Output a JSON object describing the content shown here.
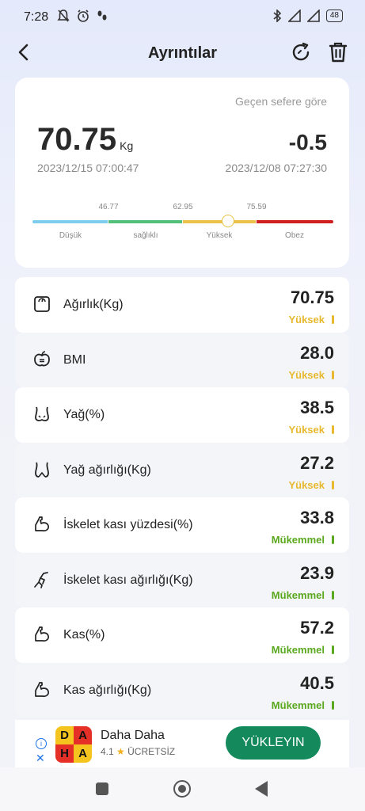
{
  "status_bar": {
    "time": "7:28",
    "battery": "48"
  },
  "header": {
    "title": "Ayrıntılar"
  },
  "summary": {
    "compare_label": "Geçen sefere göre",
    "weight": "70.75",
    "unit": "Kg",
    "difference": "-0.5",
    "current_date": "2023/12/15 07:00:47",
    "previous_date": "2023/12/08 07:27:30",
    "scale": {
      "ticks": [
        "46.77",
        "62.95",
        "75.59"
      ],
      "segments": [
        {
          "label": "Düşük",
          "color": "#7ccdee"
        },
        {
          "label": "sağlıklı",
          "color": "#52c07a"
        },
        {
          "label": "Yüksek",
          "color": "#ecc34a"
        },
        {
          "label": "Obez",
          "color": "#cf1f1f"
        }
      ],
      "marker_value": 70.75
    }
  },
  "metrics": [
    {
      "icon": "scale-icon",
      "label": "Ağırlık(Kg)",
      "value": "70.75",
      "status": "Yüksek",
      "status_color": "#e8b92e"
    },
    {
      "icon": "apple-icon",
      "label": "BMI",
      "value": "28.0",
      "status": "Yüksek",
      "status_color": "#e8b92e"
    },
    {
      "icon": "body-fat-icon",
      "label": "Yağ(%)",
      "value": "38.5",
      "status": "Yüksek",
      "status_color": "#e8b92e"
    },
    {
      "icon": "body-fat-weight-icon",
      "label": "Yağ ağırlığı(Kg)",
      "value": "27.2",
      "status": "Yüksek",
      "status_color": "#e8b92e"
    },
    {
      "icon": "arm-muscle-icon",
      "label": "İskelet kası yüzdesi(%)",
      "value": "33.8",
      "status": "Mükemmel",
      "status_color": "#5aa81e"
    },
    {
      "icon": "running-icon",
      "label": "İskelet kası ağırlığı(Kg)",
      "value": "23.9",
      "status": "Mükemmel",
      "status_color": "#5aa81e"
    },
    {
      "icon": "arm-muscle-icon",
      "label": "Kas(%)",
      "value": "57.2",
      "status": "Mükemmel",
      "status_color": "#5aa81e"
    },
    {
      "icon": "arm-muscle-icon",
      "label": "Kas ağırlığı(Kg)",
      "value": "40.5",
      "status": "Mükemmel",
      "status_color": "#5aa81e"
    }
  ],
  "ad": {
    "app_name": "Daha Daha",
    "rating": "4.1",
    "price": "ÜCRETSİZ",
    "install_label": "YÜKLEYIN",
    "logo_letters": [
      "D",
      "A",
      "H",
      "A"
    ]
  }
}
